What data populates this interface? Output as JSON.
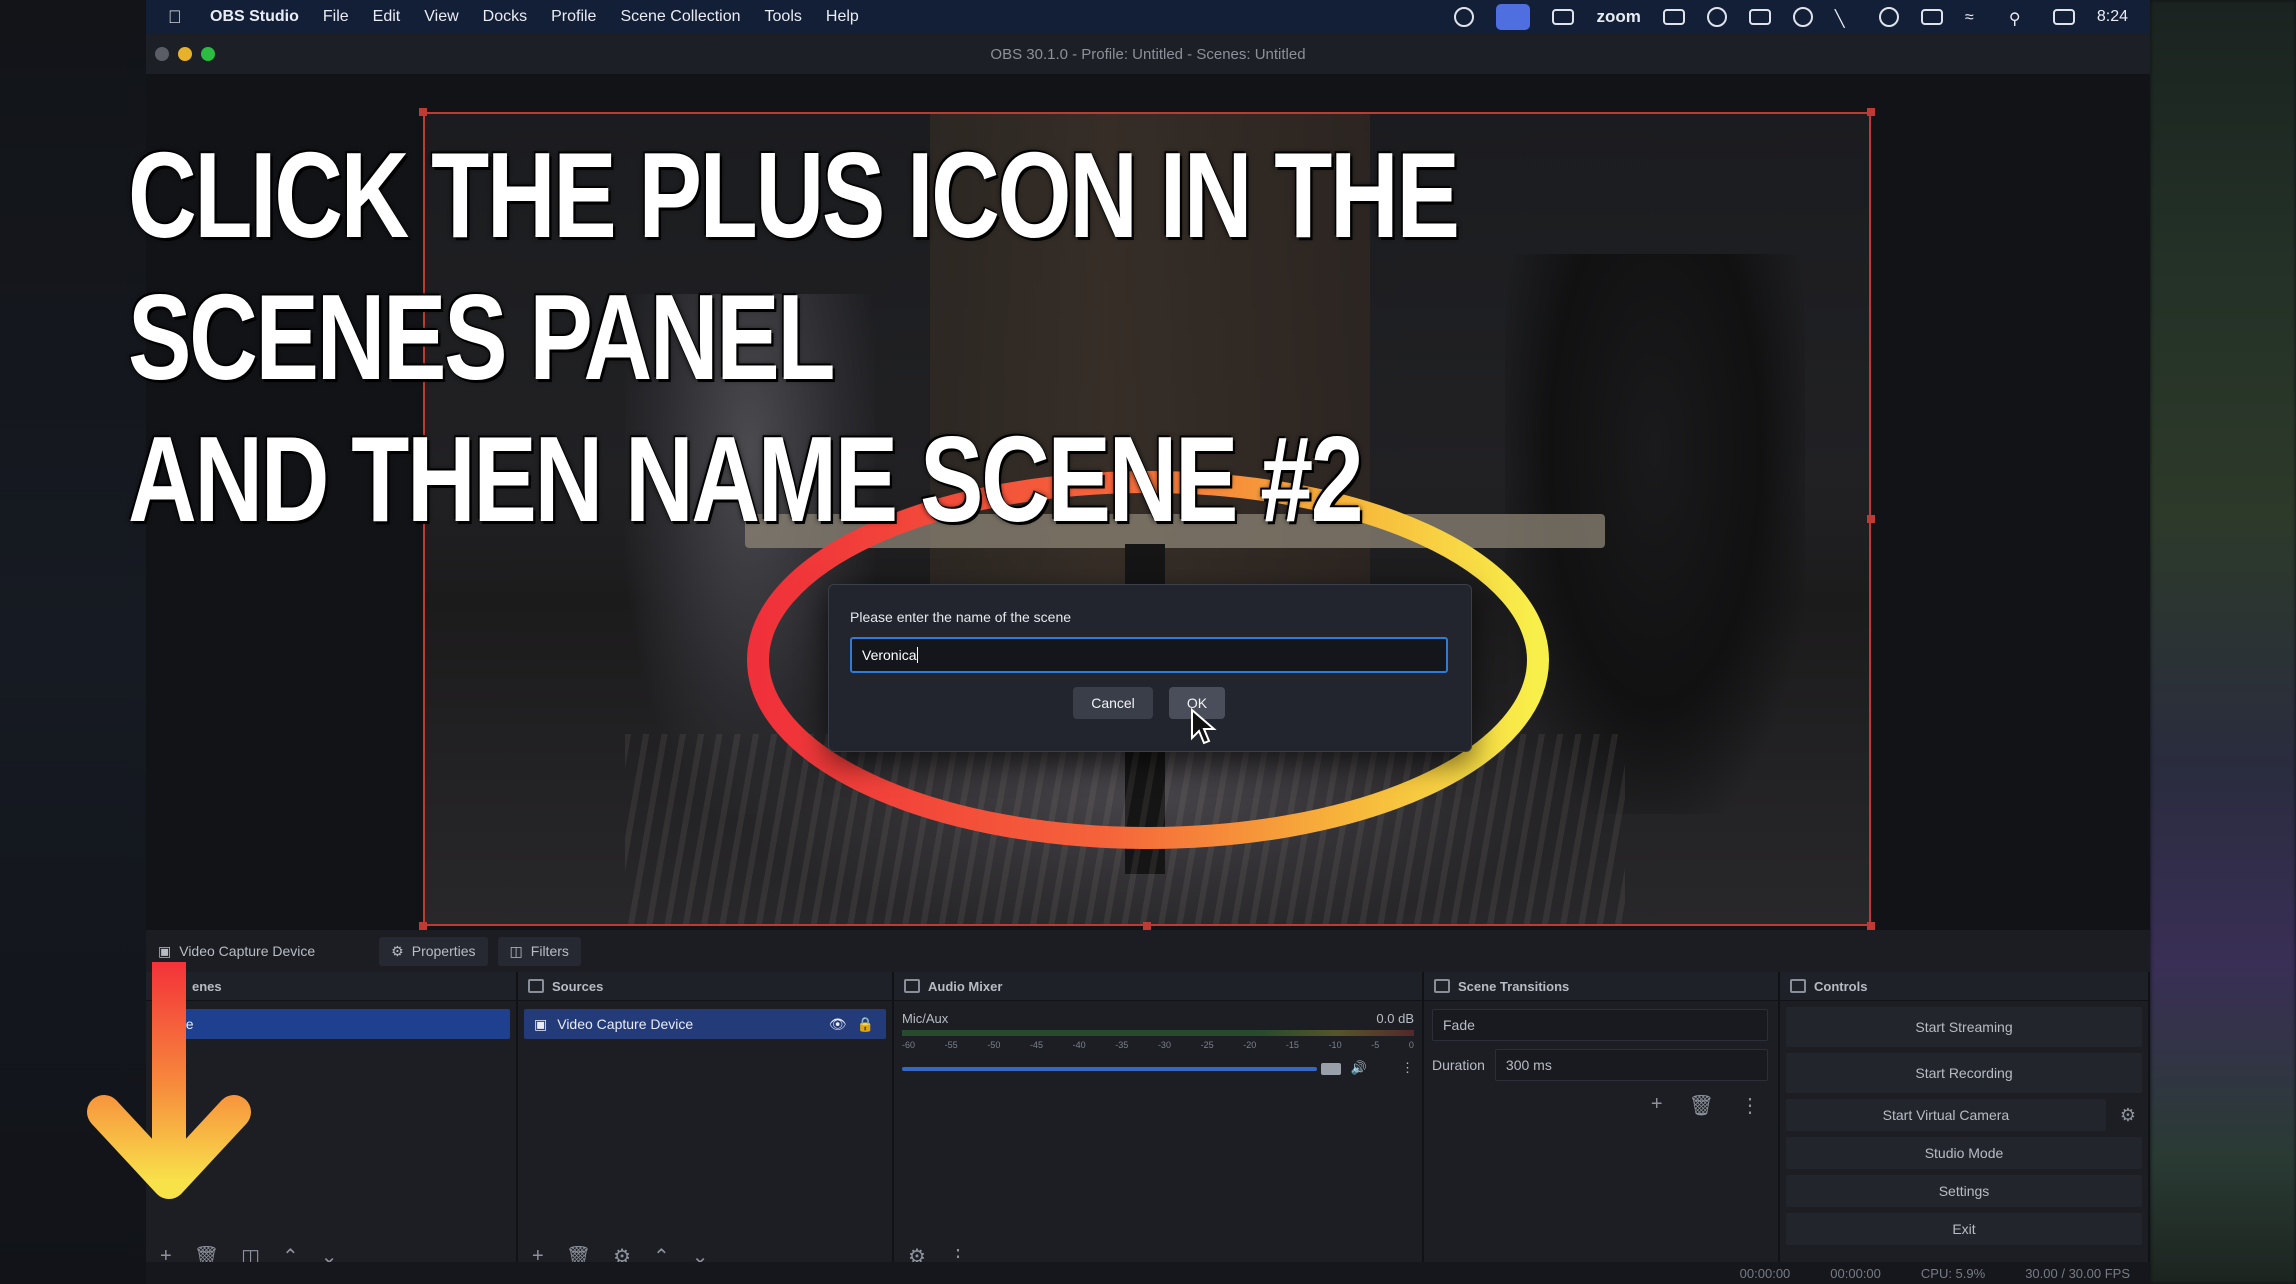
{
  "menubar": {
    "app_name": "OBS Studio",
    "items": [
      "File",
      "Edit",
      "View",
      "Docks",
      "Profile",
      "Scene Collection",
      "Tools",
      "Help"
    ],
    "zoom_label": "zoom",
    "clock": "8:24"
  },
  "window": {
    "title": "OBS 30.1.0 - Profile: Untitled - Scenes: Untitled"
  },
  "headline": {
    "line1": "CLICK THE PLUS ICON IN THE SCENES PANEL",
    "line2": "AND THEN NAME SCENE #2"
  },
  "dialog": {
    "prompt": "Please enter the name of the scene",
    "input_value": "Veronica",
    "cancel_label": "Cancel",
    "ok_label": "OK"
  },
  "source_toolbar": {
    "source_name": "Video Capture Device",
    "properties_label": "Properties",
    "filters_label": "Filters"
  },
  "docks": {
    "scenes": {
      "title_visible": "enes",
      "selected_visible": "ne"
    },
    "sources": {
      "title": "Sources",
      "item": "Video Capture Device"
    },
    "audio_mixer": {
      "title": "Audio Mixer",
      "channel": "Mic/Aux",
      "level": "0.0 dB",
      "ticks": [
        "-60",
        "-55",
        "-50",
        "-45",
        "-40",
        "-35",
        "-30",
        "-25",
        "-20",
        "-15",
        "-10",
        "-5",
        "0"
      ]
    },
    "transitions": {
      "title": "Scene Transitions",
      "type": "Fade",
      "duration_label": "Duration",
      "duration_value": "300 ms"
    },
    "controls": {
      "title": "Controls",
      "buttons": [
        "Start Streaming",
        "Start Recording",
        "Start Virtual Camera",
        "Studio Mode",
        "Settings",
        "Exit"
      ]
    }
  },
  "status": {
    "time1": "00:00:00",
    "time2": "00:00:00",
    "cpu": "CPU: 5.9%",
    "fps": "30.00 / 30.00 FPS"
  },
  "colors": {
    "accent_blue": "#2e7bd8",
    "selection": "#1f3f8f",
    "canvas_border": "#c03a35"
  }
}
